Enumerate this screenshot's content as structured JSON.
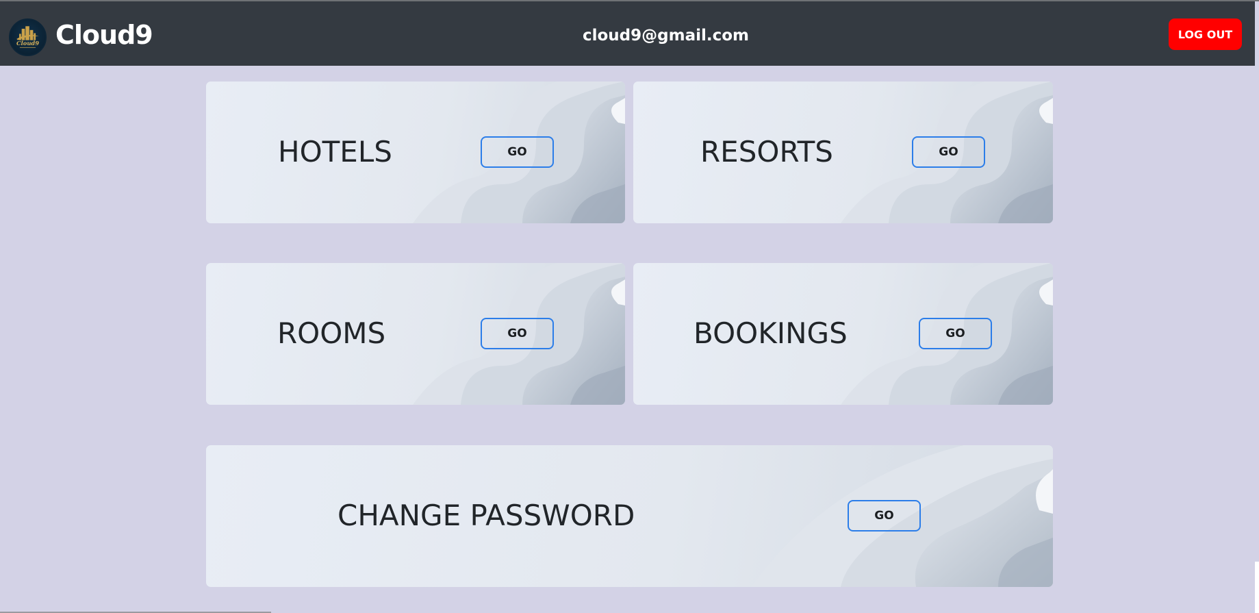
{
  "app": {
    "brand": "Cloud9",
    "logo_text": "Cloud9",
    "user_email": "cloud9@gmail.com",
    "logout_label": "LOG OUT"
  },
  "cards": [
    {
      "title": "HOTELS",
      "button_label": "GO"
    },
    {
      "title": "RESORTS",
      "button_label": "GO"
    },
    {
      "title": "ROOMS",
      "button_label": "GO"
    },
    {
      "title": "BOOKINGS",
      "button_label": "GO"
    },
    {
      "title": "CHANGE PASSWORD",
      "button_label": "GO"
    }
  ],
  "colors": {
    "navbar": "#343a41",
    "page_background": "#d3d2e6",
    "logout_button": "#ff0000",
    "go_button_border": "#2b7de9",
    "card_text": "#212529"
  },
  "icons": {
    "logo": "hotel-building-logo-icon"
  }
}
